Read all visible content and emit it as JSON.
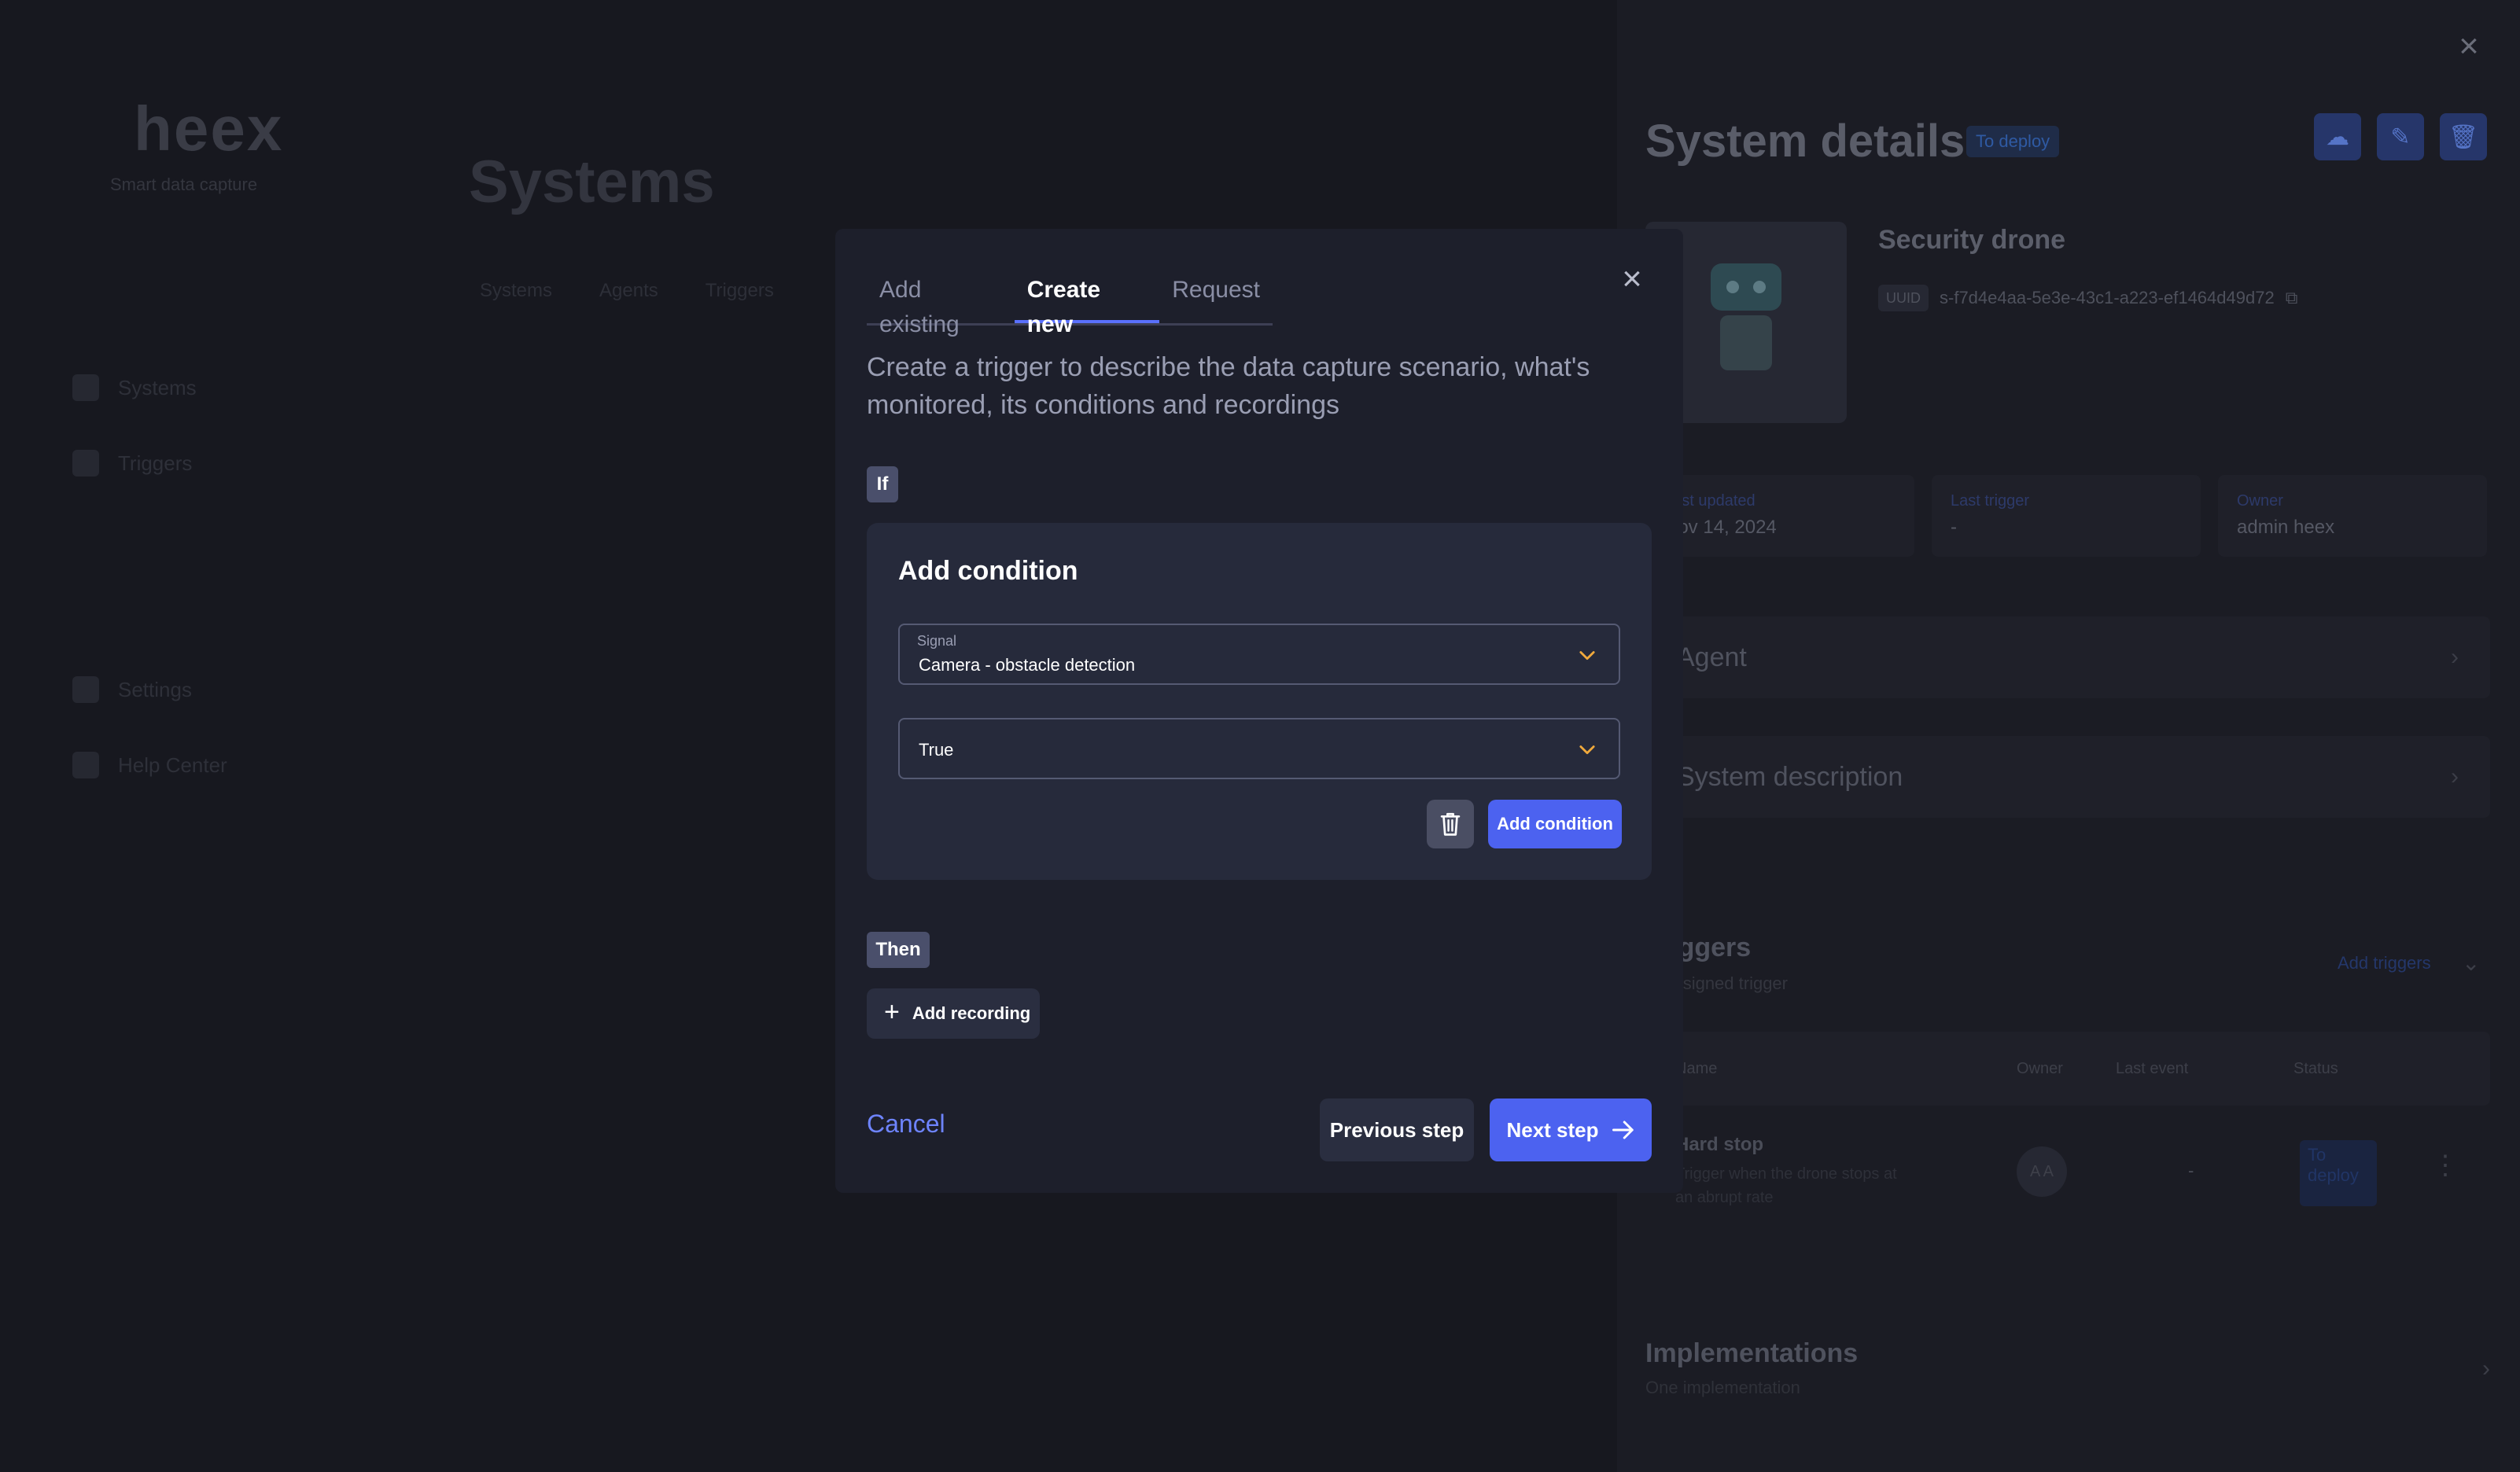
{
  "background": {
    "logo": "heex",
    "logo_sub": "Smart data capture",
    "page_title": "Systems",
    "page_tabs": [
      "Systems",
      "Agents",
      "Triggers"
    ],
    "nav": [
      "Systems",
      "Triggers",
      "Settings",
      "Help Center"
    ]
  },
  "panel": {
    "title": "System details",
    "status_badge": "To deploy",
    "system_name": "Security drone",
    "uuid_label": "UUID",
    "uuid": "s-f7d4e4aa-5e3e-43c1-a223-ef1464d49d72",
    "stats": [
      {
        "label": "Last updated",
        "value": "Nov 14, 2024"
      },
      {
        "label": "Last trigger",
        "value": "-"
      },
      {
        "label": "Owner",
        "value": "admin heex"
      }
    ],
    "sections": [
      "Agent",
      "System description"
    ],
    "triggers": {
      "title": "Triggers",
      "subtitle": "One signed trigger",
      "add_label": "Add triggers",
      "columns": [
        "Name",
        "Owner",
        "Last event",
        "Status"
      ],
      "rows": [
        {
          "name": "Hard stop",
          "description": "Trigger when the drone stops at an abrupt rate",
          "owner_initials": "A A",
          "last_event": "-",
          "status": "To deploy"
        }
      ]
    },
    "implementations": {
      "title": "Implementations",
      "subtitle": "One implementation"
    }
  },
  "modal": {
    "tabs": [
      {
        "label": "Add existing",
        "active": false
      },
      {
        "label": "Create new",
        "active": true
      },
      {
        "label": "Request",
        "active": false
      }
    ],
    "intro": "Create a trigger to describe the data capture scenario, what's monitored, its conditions and recordings",
    "if_label": "If",
    "condition": {
      "title": "Add condition",
      "signal_label": "Signal",
      "signal_value": "Camera - obstacle detection",
      "value": "True",
      "add_button": "Add condition"
    },
    "then_label": "Then",
    "add_recording": "Add recording",
    "cancel": "Cancel",
    "previous": "Previous step",
    "next": "Next step",
    "accent_color": "#4c62f0",
    "caret_color": "#f0a93c"
  }
}
